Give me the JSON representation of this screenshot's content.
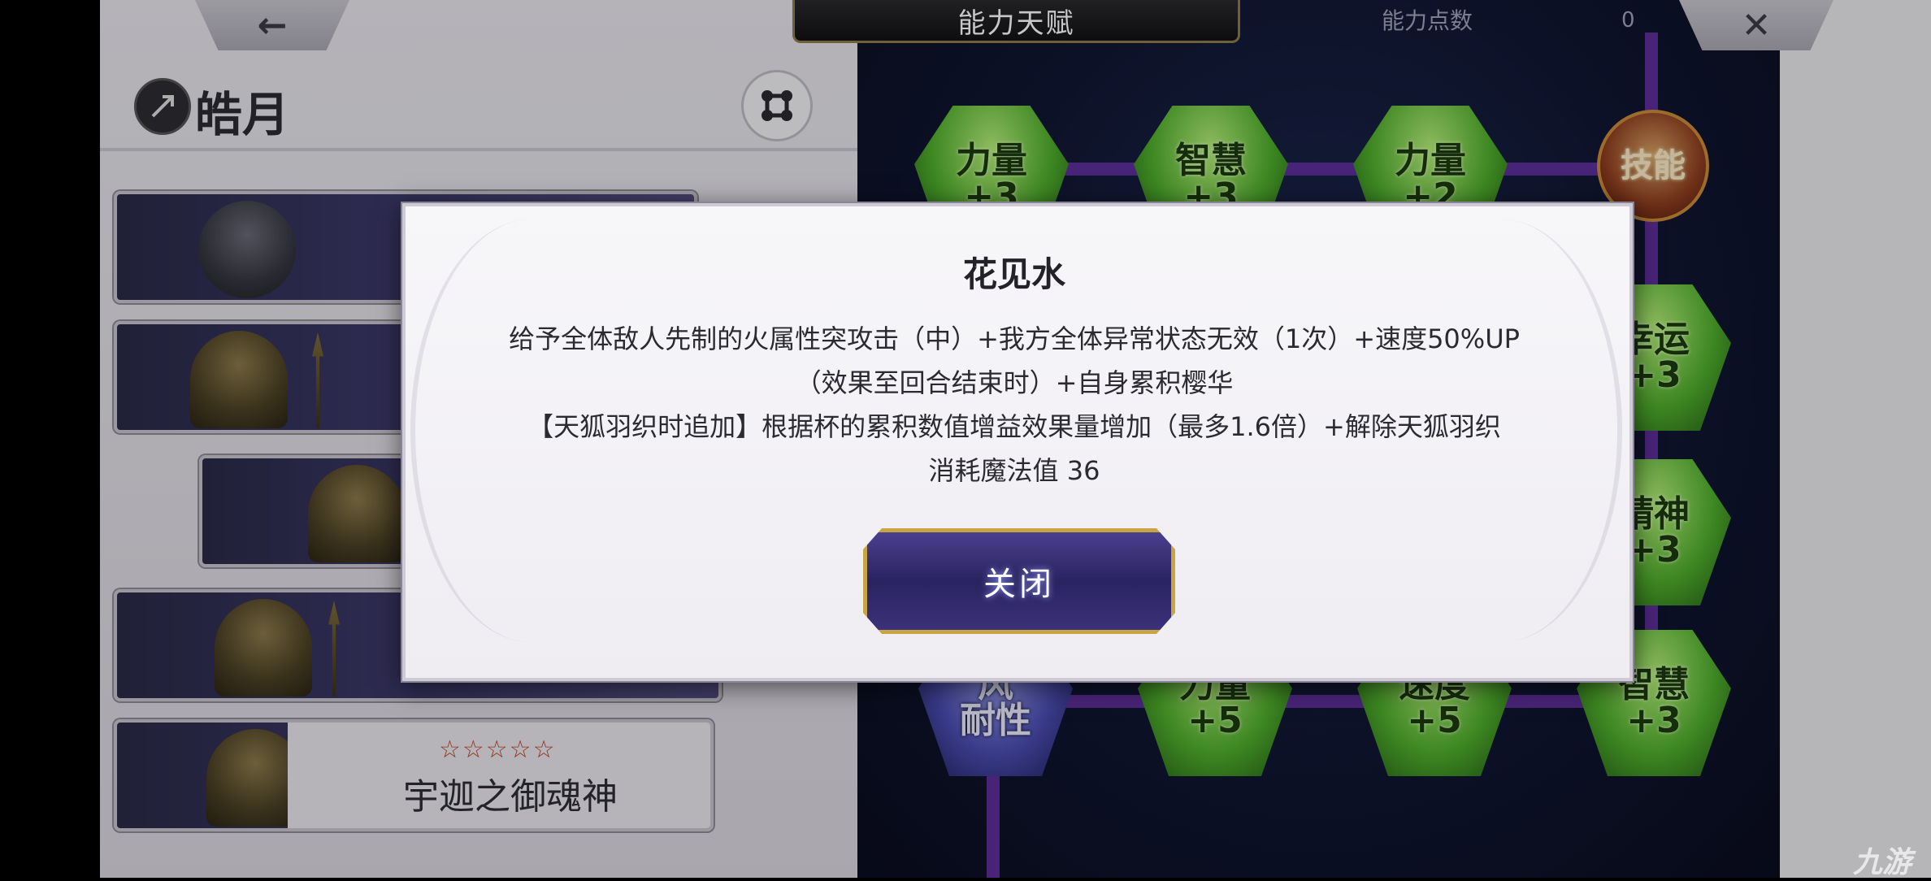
{
  "header": {
    "back_icon": "←",
    "title": "能力天赋",
    "points_label": "能力点数",
    "points_value": "0",
    "close_icon": "✕"
  },
  "character": {
    "name": "皓月"
  },
  "summon_cards": [
    {
      "stars": "☆☆☆☆☆",
      "name": "宇迦之御魂神"
    }
  ],
  "talent_nodes": [
    {
      "line1": "力量",
      "line2": "+3"
    },
    {
      "line1": "智慧",
      "line2": "+3"
    },
    {
      "line1": "力量",
      "line2": "+2"
    },
    {
      "line1": "技能"
    },
    {
      "line1": "幸运",
      "line2": "+3"
    },
    {
      "line1": "精神",
      "line2": "+3"
    },
    {
      "line1": "风",
      "line2": "耐性"
    },
    {
      "line1": "力量",
      "line2": "+5"
    },
    {
      "line1": "速度",
      "line2": "+5"
    },
    {
      "line1": "智慧",
      "line2": "+3"
    }
  ],
  "modal": {
    "title": "花见水",
    "lines": [
      "给予全体敌人先制的火属性突攻击（中）+我方全体异常状态无效（1次）+速度50%UP",
      "（效果至回合结束时）+自身累积樱华",
      "【天狐羽织时追加】根据杯的累积数值增益效果量增加（最多1.6倍）+解除天狐羽织",
      "消耗魔法值 36"
    ],
    "close_label": "关闭"
  },
  "watermark": "九游"
}
